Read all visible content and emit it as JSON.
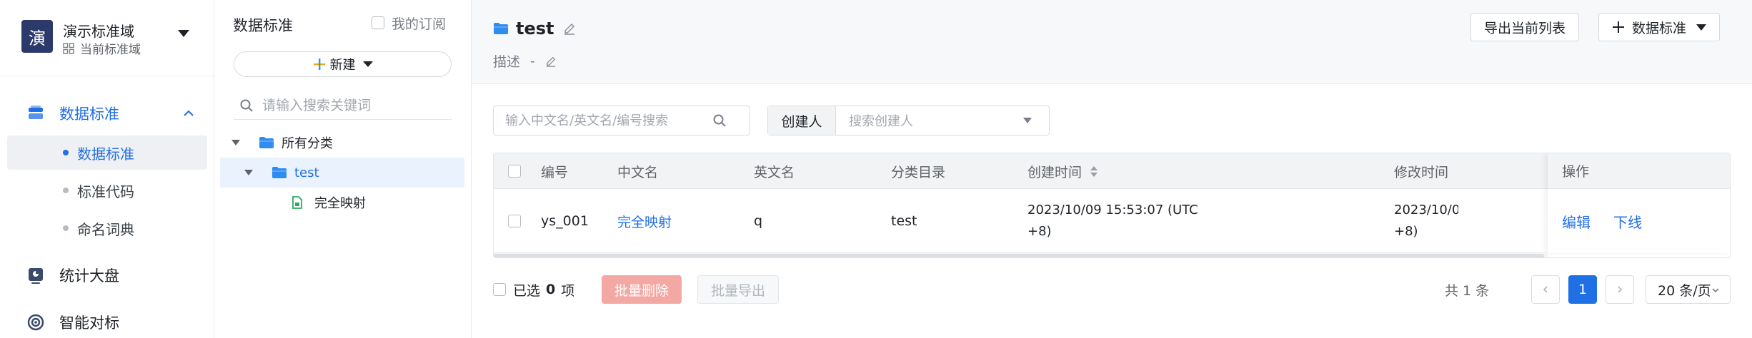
{
  "workspace": {
    "avatar_char": "演",
    "name": "演示标准域",
    "subtitle": "当前标准域"
  },
  "sidebar": {
    "groups": [
      {
        "label": "数据标准",
        "icon": "data-standard-icon",
        "expanded": true
      },
      {
        "label": "统计大盘",
        "icon": "dashboard-icon"
      },
      {
        "label": "智能对标",
        "icon": "smart-match-icon"
      }
    ],
    "subitems": [
      {
        "label": "数据标准",
        "active": true
      },
      {
        "label": "标准代码"
      },
      {
        "label": "命名词典"
      }
    ]
  },
  "tree_panel": {
    "title": "数据标准",
    "subscribe_label": "我的订阅",
    "new_button": "新建",
    "search_placeholder": "请输入搜索关键词",
    "nodes": [
      {
        "label": "所有分类",
        "level": 0
      },
      {
        "label": "test",
        "level": 1,
        "selected": true
      },
      {
        "label": "完全映射",
        "level": 2
      }
    ]
  },
  "main": {
    "title": "test",
    "desc_label": "描述",
    "desc_value": "-",
    "export_button": "导出当前列表",
    "standard_button": "数据标准",
    "search_placeholder": "输入中文名/英文名/编号搜索",
    "creator_label": "创建人",
    "creator_placeholder": "搜索创建人"
  },
  "table": {
    "headers": {
      "code": "编号",
      "cn_name": "中文名",
      "en_name": "英文名",
      "category": "分类目录",
      "created": "创建时间",
      "modified": "修改时间",
      "actions": "操作"
    },
    "rows": [
      {
        "code": "ys_001",
        "cn_name": "完全映射",
        "en_name": "q",
        "category": "test",
        "created": "2023/10/09 15:53:07 (UTC +8)",
        "modified": "2023/10/0 +8)",
        "action_edit": "编辑",
        "action_offline": "下线"
      }
    ]
  },
  "footer": {
    "selected_prefix": "已选",
    "selected_count": "0",
    "selected_suffix": "项",
    "batch_delete": "批量删除",
    "batch_export": "批量导出",
    "total": "共 1 条",
    "current_page": "1",
    "page_size": "20 条/页"
  },
  "colors": {
    "accent": "#1f6fe5",
    "danger_disabled": "#f4a8a4",
    "workspace_avatar": "#2c3a6b"
  }
}
